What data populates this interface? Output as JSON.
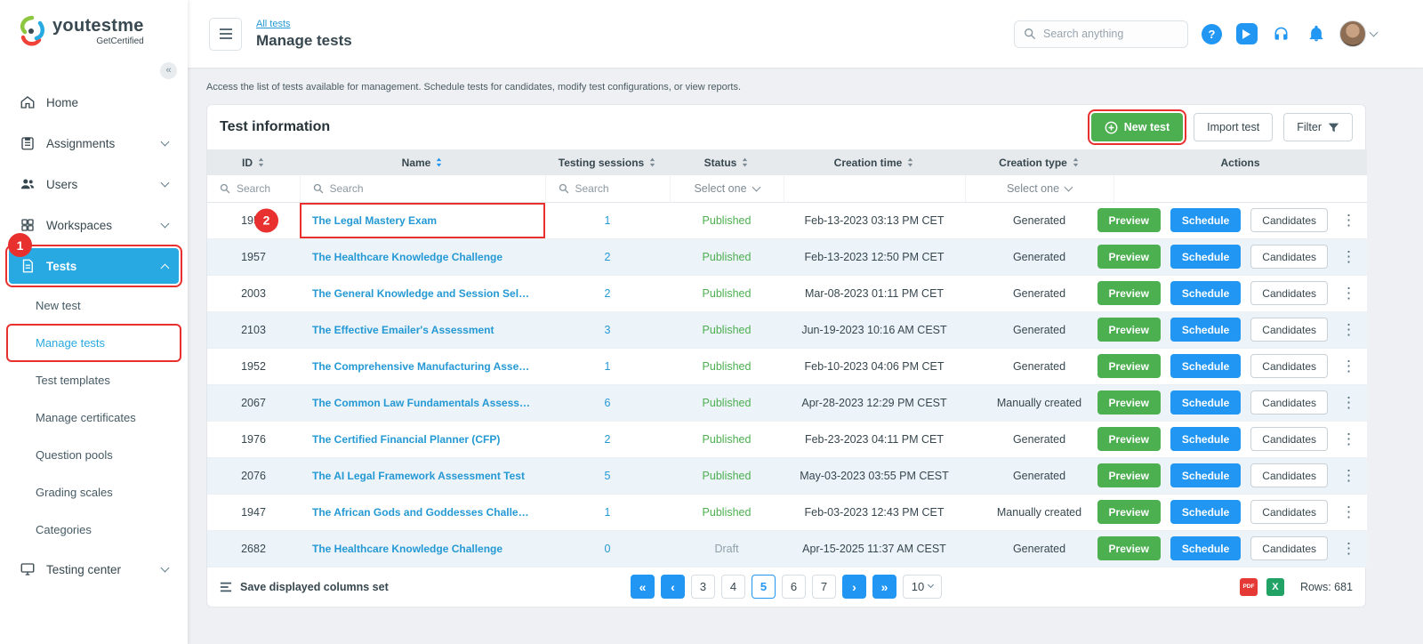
{
  "brand": {
    "name": "youtestme",
    "subtitle": "GetCertified"
  },
  "sidebar": {
    "items": [
      {
        "label": "Home"
      },
      {
        "label": "Assignments"
      },
      {
        "label": "Users"
      },
      {
        "label": "Workspaces"
      },
      {
        "label": "Tests"
      }
    ],
    "subitems": [
      {
        "label": "New test"
      },
      {
        "label": "Manage tests"
      },
      {
        "label": "Test templates"
      },
      {
        "label": "Manage certificates"
      },
      {
        "label": "Question pools"
      },
      {
        "label": "Grading scales"
      },
      {
        "label": "Categories"
      }
    ],
    "bottom": [
      {
        "label": "Testing center"
      }
    ]
  },
  "header": {
    "breadcrumb": "All tests",
    "title": "Manage tests",
    "search_placeholder": "Search anything"
  },
  "page": {
    "description": "Access the list of tests available for management. Schedule tests for candidates, modify test configurations, or view reports."
  },
  "card": {
    "title": "Test information",
    "new_test": "New test",
    "import_test": "Import test",
    "filter": "Filter"
  },
  "table": {
    "columns": [
      "ID",
      "Name",
      "Testing sessions",
      "Status",
      "Creation time",
      "Creation type",
      "Actions"
    ],
    "filters": {
      "id": "Search",
      "name": "Search",
      "sessions": "Search",
      "status": "Select one",
      "creation_type": "Select one"
    },
    "actions": {
      "preview": "Preview",
      "schedule": "Schedule",
      "candidates": "Candidates"
    },
    "rows": [
      {
        "id": "1958",
        "name": "The Legal Mastery Exam",
        "sessions": "1",
        "status": "Published",
        "creation_time": "Feb-13-2023 03:13 PM CET",
        "creation_type": "Generated",
        "annotated": true
      },
      {
        "id": "1957",
        "name": "The Healthcare Knowledge Challenge",
        "sessions": "2",
        "status": "Published",
        "creation_time": "Feb-13-2023 12:50 PM CET",
        "creation_type": "Generated"
      },
      {
        "id": "2003",
        "name": "The General Knowledge and Session Self-Enr…",
        "sessions": "2",
        "status": "Published",
        "creation_time": "Mar-08-2023 01:11 PM CET",
        "creation_type": "Generated"
      },
      {
        "id": "2103",
        "name": "The Effective Emailer's Assessment",
        "sessions": "3",
        "status": "Published",
        "creation_time": "Jun-19-2023 10:16 AM CEST",
        "creation_type": "Generated"
      },
      {
        "id": "1952",
        "name": "The Comprehensive Manufacturing Assessm…",
        "sessions": "1",
        "status": "Published",
        "creation_time": "Feb-10-2023 04:06 PM CET",
        "creation_type": "Generated"
      },
      {
        "id": "2067",
        "name": "The Common Law Fundamentals Assessment",
        "sessions": "6",
        "status": "Published",
        "creation_time": "Apr-28-2023 12:29 PM CEST",
        "creation_type": "Manually created"
      },
      {
        "id": "1976",
        "name": "The Certified Financial Planner (CFP)",
        "sessions": "2",
        "status": "Published",
        "creation_time": "Feb-23-2023 04:11 PM CET",
        "creation_type": "Generated"
      },
      {
        "id": "2076",
        "name": "The AI Legal Framework Assessment Test",
        "sessions": "5",
        "status": "Published",
        "creation_time": "May-03-2023 03:55 PM CEST",
        "creation_type": "Generated"
      },
      {
        "id": "1947",
        "name": "The African Gods and Goddesses Challenge",
        "sessions": "1",
        "status": "Published",
        "creation_time": "Feb-03-2023 12:43 PM CET",
        "creation_type": "Manually created"
      },
      {
        "id": "2682",
        "name": "The Healthcare Knowledge Challenge",
        "sessions": "0",
        "status": "Draft",
        "creation_time": "Apr-15-2025 11:37 AM CEST",
        "creation_type": "Generated"
      }
    ]
  },
  "footer": {
    "save_columns": "Save displayed columns set",
    "pages": [
      "3",
      "4",
      "5",
      "6",
      "7"
    ],
    "active_page": "5",
    "page_size": "10",
    "rows": "Rows: 681"
  },
  "annotations": {
    "step1": "1",
    "step2": "2"
  },
  "icons": {
    "help": "?",
    "collapse": "«",
    "kebab": "⋮",
    "pag_first": "«",
    "pag_prev": "‹",
    "pag_next": "›",
    "pag_last": "»",
    "pdf": "PDF",
    "excel": "X"
  },
  "colors": {
    "accent": "#29a9e1",
    "blue": "#2196f3",
    "green": "#4caf50",
    "link": "#2499d4",
    "published": "#4caf50",
    "draft": "#90a0a9",
    "annotation": "#e8312f",
    "row-alt": "#ecf3f9"
  }
}
